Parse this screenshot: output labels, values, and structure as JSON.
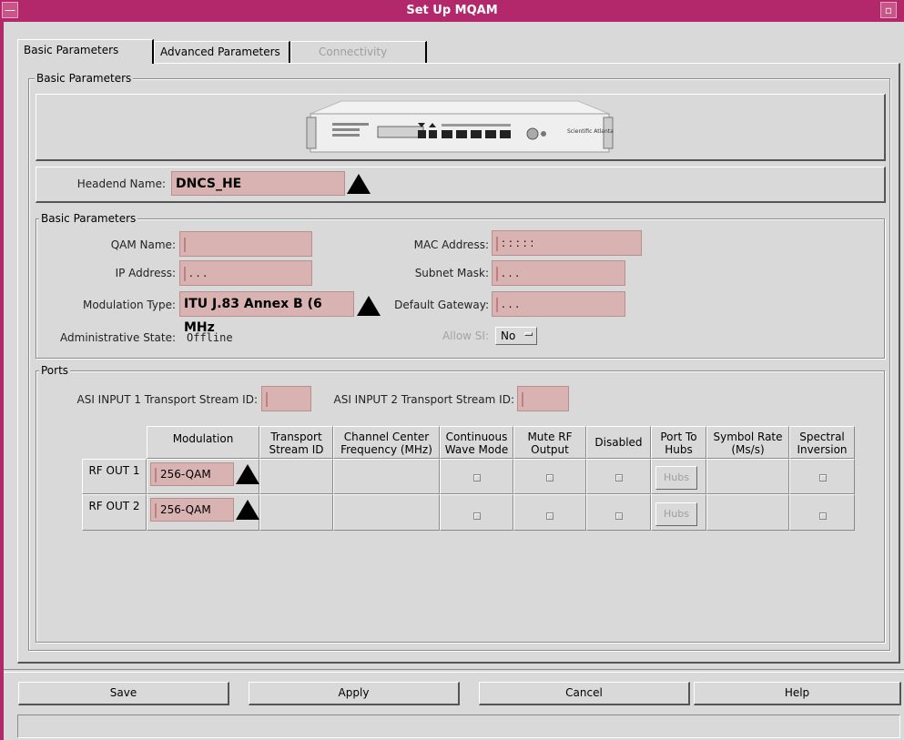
{
  "window": {
    "title": "Set Up MQAM",
    "minimize_label": "—",
    "maximize_label": "▫"
  },
  "tabs": [
    {
      "label": "Basic Parameters",
      "state": "active"
    },
    {
      "label": "Advanced Parameters",
      "state": "normal"
    },
    {
      "label": "Connectivity",
      "state": "disabled"
    }
  ],
  "basic_group": {
    "legend": "Basic Parameters"
  },
  "device_image": {
    "brand": "Scientific Atlanta",
    "icon": "mqam-device-image"
  },
  "headend": {
    "label": "Headend Name:",
    "value": "DNCS_HE"
  },
  "params": {
    "legend": "Basic Parameters",
    "qam_name": {
      "label": "QAM Name:",
      "value": ""
    },
    "ip_address": {
      "label": "IP Address:",
      "value": ". . ."
    },
    "modulation_type": {
      "label": "Modulation Type:",
      "value": "ITU J.83 Annex B (6 MHz"
    },
    "admin_state": {
      "label": "Administrative State:",
      "value": "Offline"
    },
    "mac_address": {
      "label": "MAC Address:",
      "value": ": : : : :"
    },
    "subnet_mask": {
      "label": "Subnet Mask:",
      "value": ". . ."
    },
    "default_gateway": {
      "label": "Default Gateway:",
      "value": ". . ."
    },
    "allow_si": {
      "label": "Allow SI:",
      "value": "No"
    }
  },
  "ports": {
    "legend": "Ports",
    "asi1_label": "ASI INPUT 1 Transport Stream ID:",
    "asi1_value": "",
    "asi2_label": "ASI INPUT 2 Transport Stream ID:",
    "asi2_value": "",
    "columns": [
      "Modulation",
      "Transport Stream ID",
      "Channel Center Frequency (MHz)",
      "Continuous Wave Mode",
      "Mute RF Output",
      "Disabled",
      "Port To Hubs",
      "Symbol Rate (Ms/s)",
      "Spectral Inversion"
    ],
    "rows": [
      {
        "label": "RF OUT 1",
        "modulation": "256-QAM",
        "hubs": "Hubs"
      },
      {
        "label": "RF OUT 2",
        "modulation": "256-QAM",
        "hubs": "Hubs"
      }
    ]
  },
  "buttons": {
    "save": "Save",
    "apply": "Apply",
    "cancel": "Cancel",
    "help": "Help"
  },
  "colors": {
    "title_bar": "#b3276b",
    "field_bg": "#d9b2b2",
    "window_bg": "#d9d9d9"
  }
}
